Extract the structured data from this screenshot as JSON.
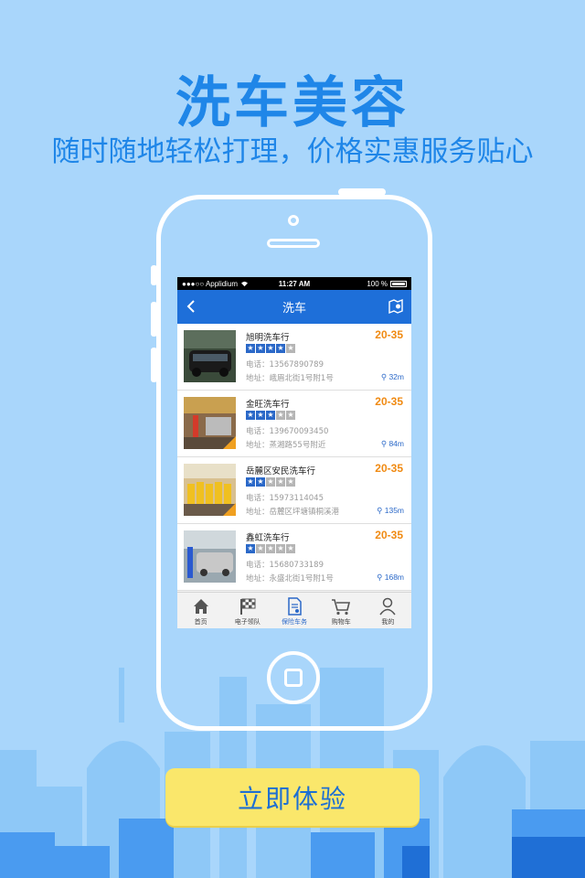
{
  "promo": {
    "title": "洗车美容",
    "subtitle": "随时随地轻松打理，价格实惠服务贴心",
    "cta_label": "立即体验"
  },
  "statusbar": {
    "carrier": "●●●○○ Applidium",
    "time": "11:27 AM",
    "battery": "100 %"
  },
  "navbar": {
    "title": "洗车"
  },
  "shops": [
    {
      "name": "旭明洗车行",
      "rating": 4,
      "price": "20-35",
      "phone": "电话：13567890789",
      "address": "地址：峨眉北街1号附1号",
      "distance": "32m",
      "tag": false
    },
    {
      "name": "金旺洗车行",
      "rating": 3,
      "price": "20-35",
      "phone": "电话：139670093450",
      "address": "地址：蒸湘路55号附近",
      "distance": "84m",
      "tag": true
    },
    {
      "name": "岳麓区安民洗车行",
      "rating": 2,
      "price": "20-35",
      "phone": "电话：15973114045",
      "address": "地址：岳麓区坪塘镇桐溪港",
      "distance": "135m",
      "tag": true
    },
    {
      "name": "鑫虹洗车行",
      "rating": 1,
      "price": "20-35",
      "phone": "电话：15680733189",
      "address": "地址：永盛北街1号附1号",
      "distance": "168m",
      "tag": false
    }
  ],
  "tabs": [
    {
      "label": "首页",
      "icon": "home-icon"
    },
    {
      "label": "电子领队",
      "icon": "checkered-flag-icon"
    },
    {
      "label": "保险车务",
      "icon": "document-icon"
    },
    {
      "label": "购物车",
      "icon": "cart-icon"
    },
    {
      "label": "我的",
      "icon": "user-icon"
    }
  ],
  "colors": {
    "background": "#a9d6fb",
    "accent": "#1f86e8",
    "navbar": "#1e6fd9",
    "price": "#f08a12",
    "cta_bg": "#fae76b"
  }
}
